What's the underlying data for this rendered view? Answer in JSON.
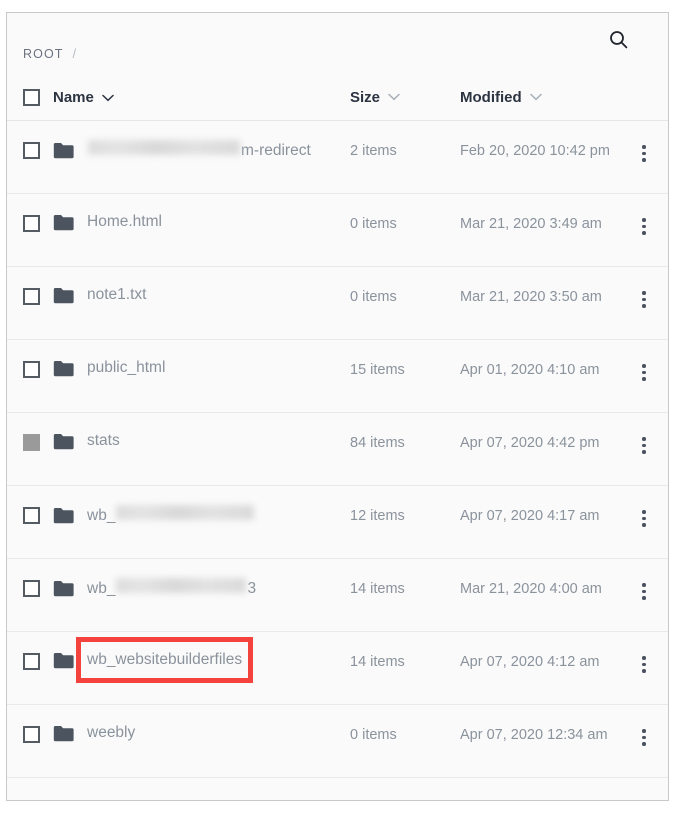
{
  "breadcrumb": {
    "root_label": "ROOT",
    "separator": "/"
  },
  "search": {
    "icon": "search-icon"
  },
  "columns": {
    "name": "Name",
    "size": "Size",
    "modified": "Modified"
  },
  "icons": {
    "folder": "folder-icon",
    "chevron_down": "chevron-down-icon",
    "kebab": "more-vertical-icon",
    "checkbox": "checkbox-icon"
  },
  "colors": {
    "annotation": "#f4433d",
    "folder": "#4b545f",
    "text_muted": "#8a929c",
    "header_text": "#2b3440",
    "checkbox_filled": "#9a9a9a"
  },
  "rows": [
    {
      "name": "m-redirect",
      "blurred": true,
      "blur_width": 152,
      "size": "2 items",
      "modified": "Feb 20, 2020 10:42 pm",
      "checkbox_state": "unchecked",
      "highlighted": false
    },
    {
      "name": "Home.html",
      "blurred": false,
      "size": "0 items",
      "modified": "Mar 21, 2020 3:49 am",
      "checkbox_state": "unchecked",
      "highlighted": false
    },
    {
      "name": "note1.txt",
      "blurred": false,
      "size": "0 items",
      "modified": "Mar 21, 2020 3:50 am",
      "checkbox_state": "unchecked",
      "highlighted": false
    },
    {
      "name": "public_html",
      "blurred": false,
      "size": "15 items",
      "modified": "Apr 01, 2020 4:10 am",
      "checkbox_state": "unchecked",
      "highlighted": false
    },
    {
      "name": "stats",
      "blurred": false,
      "size": "84 items",
      "modified": "Apr 07, 2020 4:42 pm",
      "checkbox_state": "filled",
      "highlighted": false
    },
    {
      "name": "wb_",
      "blurred": true,
      "prefix": "wb_",
      "blur_width": 138,
      "size": "12 items",
      "modified": "Apr 07, 2020 4:17 am",
      "checkbox_state": "unchecked",
      "highlighted": false
    },
    {
      "name": "wb_",
      "blurred": true,
      "prefix": "wb_",
      "suffix": "3",
      "blur_width": 130,
      "size": "14 items",
      "modified": "Mar 21, 2020 4:00 am",
      "checkbox_state": "unchecked",
      "highlighted": false
    },
    {
      "name": "wb_websitebuilderfiles",
      "blurred": false,
      "size": "14 items",
      "modified": "Apr 07, 2020 4:12 am",
      "checkbox_state": "unchecked",
      "highlighted": true
    },
    {
      "name": "weebly",
      "blurred": false,
      "size": "0 items",
      "modified": "Apr 07, 2020 12:34 am",
      "checkbox_state": "unchecked",
      "highlighted": false
    }
  ]
}
